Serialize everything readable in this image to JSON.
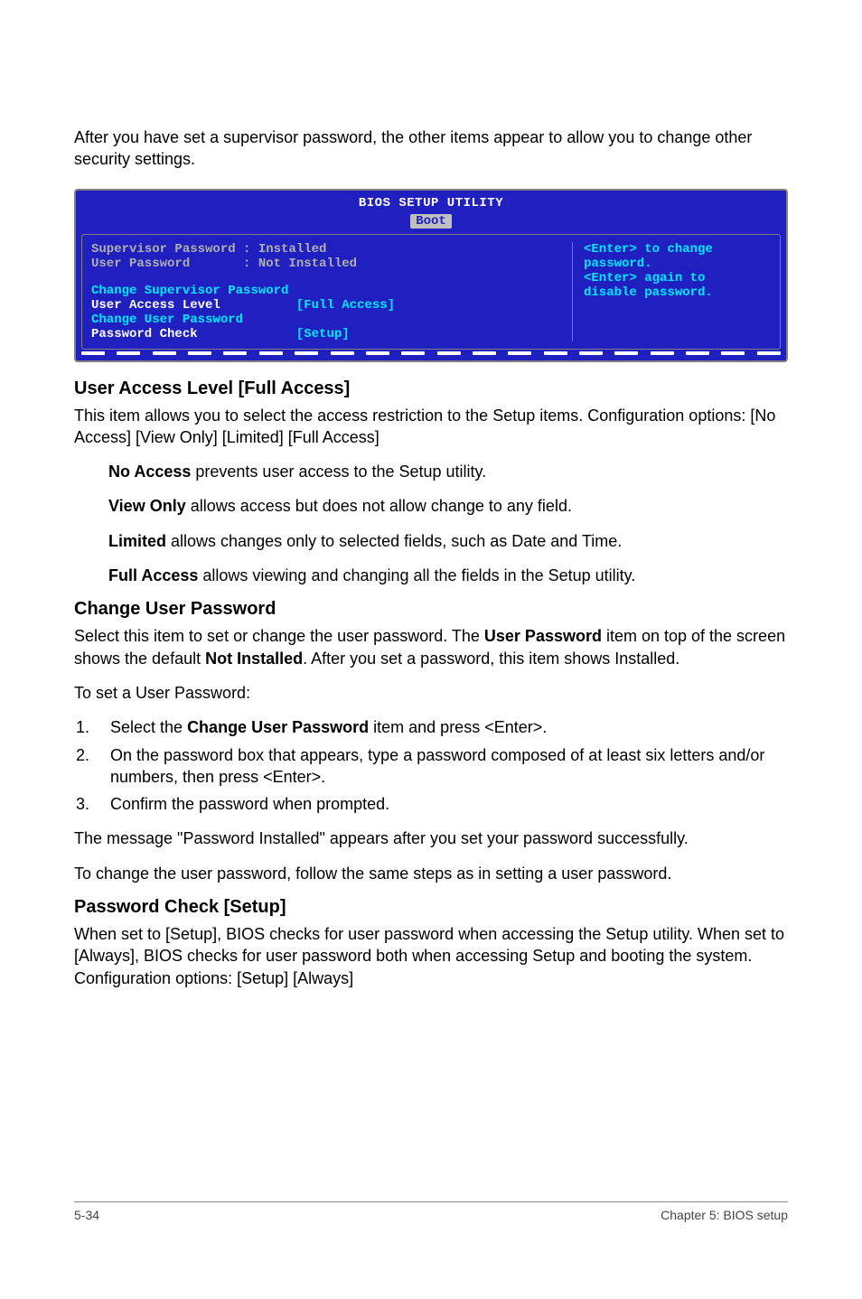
{
  "intro": "After you have set a supervisor password, the other items appear to allow you to change other security settings.",
  "bios": {
    "title": "BIOS SETUP UTILITY",
    "tab": "Boot",
    "rows": {
      "supervisor": "Supervisor Password : Installed",
      "user": "User Password       : Not Installed",
      "change_sup": "Change Supervisor Password",
      "ual_label": "User Access Level",
      "ual_value": "[Full Access]",
      "change_usr": "Change User Password",
      "pc_label": "Password Check",
      "pc_value": "[Setup]"
    },
    "help1": "<Enter> to change",
    "help2": "password.",
    "help3": "<Enter> again to",
    "help4": "disable password."
  },
  "s1": {
    "h": "User Access Level [Full Access]",
    "p1": "This item allows you to select the access restriction to the Setup items. Configuration options: [No Access] [View Only] [Limited] [Full Access]",
    "na_b": "No Access",
    "na_t": " prevents user access to the Setup utility.",
    "vo_b": "View Only",
    "vo_t": " allows access but does not allow change to any field.",
    "li_b": "Limited",
    "li_t": " allows changes only to selected fields, such as Date and Time.",
    "fa_b": "Full Access",
    "fa_t": " allows viewing and changing all the fields in the Setup utility."
  },
  "s2": {
    "h": "Change User Password",
    "p1a": "Select this item to set or change the user password. The ",
    "p1b": "User Password",
    "p1c": " item on top of the screen shows the default ",
    "p1d": "Not Installed",
    "p1e": ". After you set a password, this item shows Installed.",
    "p2": "To set a User Password:",
    "li1a": "Select the ",
    "li1b": "Change User Password",
    "li1c": " item and press <Enter>.",
    "li2": "On the password box that appears, type a password composed of at least six letters and/or numbers, then press <Enter>.",
    "li3": "Confirm the password when prompted.",
    "p3": "The message \"Password Installed\" appears after you set your password successfully.",
    "p4": "To change the user password, follow the same steps as in setting a user password."
  },
  "s3": {
    "h": "Password Check [Setup]",
    "p1": "When set to [Setup], BIOS checks for user password when accessing the Setup utility. When set to [Always], BIOS checks for user password both when accessing Setup and booting the system. Configuration options: [Setup] [Always]"
  },
  "footer": {
    "left": "5-34",
    "right": "Chapter 5: BIOS setup"
  }
}
